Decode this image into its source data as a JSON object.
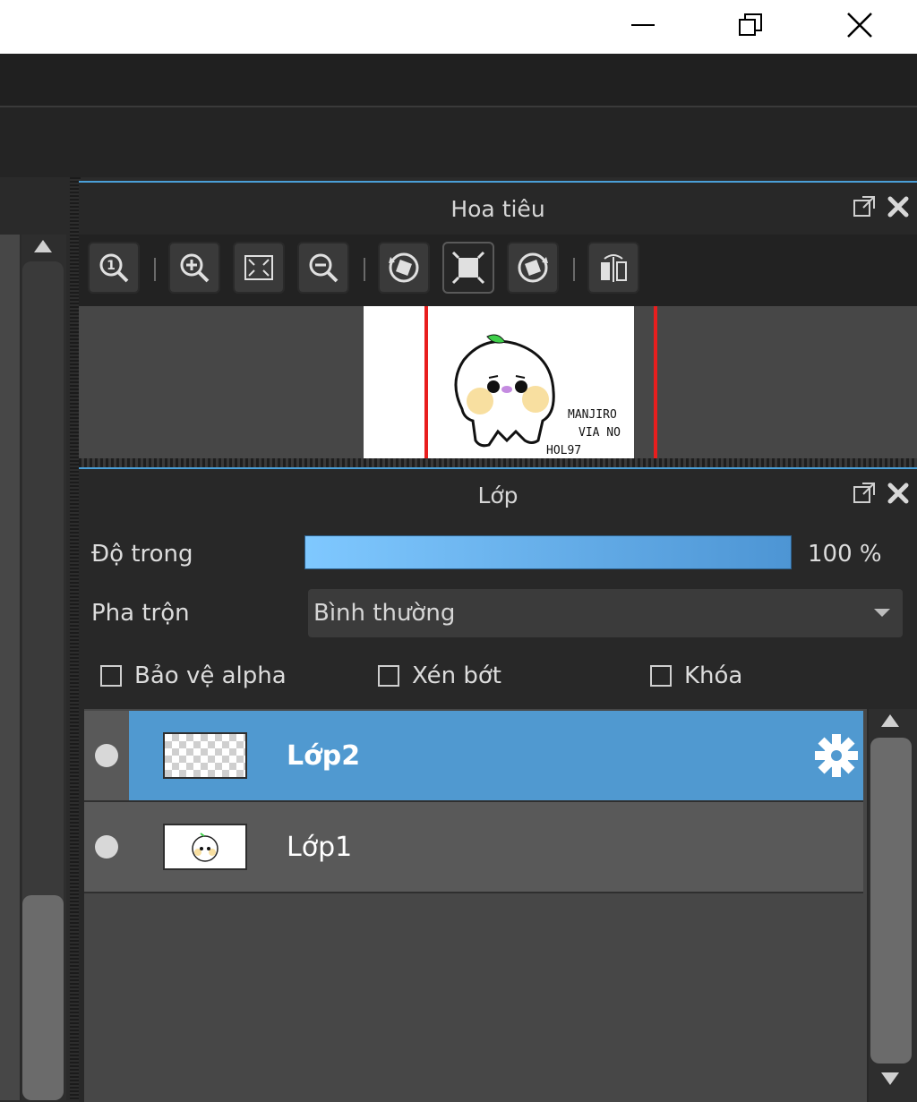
{
  "window": {
    "minimize": "minimize",
    "restore": "restore",
    "close": "close"
  },
  "navigator": {
    "title": "Hoa tiêu",
    "icons": [
      "popout-icon",
      "close-icon"
    ],
    "toolbar": [
      "zoom-reset-icon",
      "zoom-in-icon",
      "fit-icon",
      "zoom-out-icon",
      "rotate-left-icon",
      "actual-size-icon",
      "rotate-right-icon",
      "flip-icon"
    ],
    "preview_text": [
      "MANJIRO",
      "VIA NO",
      "HOL97"
    ]
  },
  "layers_panel": {
    "title": "Lớp",
    "opacity_label": "Độ trong",
    "opacity_value": "100 %",
    "opacity_fraction": 1.0,
    "blend_label": "Pha trộn",
    "blend_value": "Bình thường",
    "checkboxes": [
      {
        "label": "Bảo vệ alpha",
        "checked": false
      },
      {
        "label": "Xén bớt",
        "checked": false
      },
      {
        "label": "Khóa",
        "checked": false
      }
    ],
    "layers": [
      {
        "name": "Lớp2",
        "active": true
      },
      {
        "name": "Lớp1",
        "active": false
      }
    ]
  },
  "colors": {
    "accent": "#5099d0",
    "panel": "#282828",
    "bg": "#474747"
  }
}
